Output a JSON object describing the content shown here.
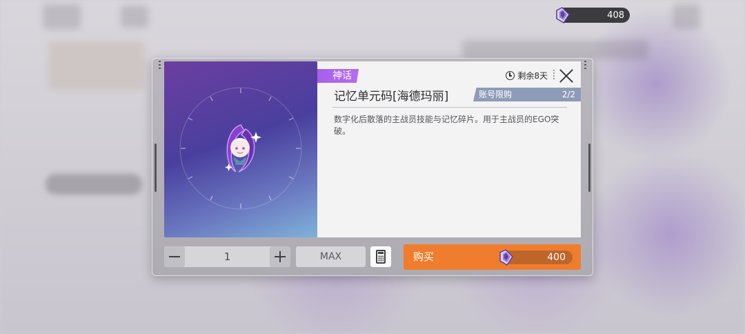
{
  "top_bar": {
    "currency_amount": "408",
    "currency_icon": "crystal-icon"
  },
  "dialog": {
    "rarity": "神话",
    "item_name": "记忆单元码[海德玛丽]",
    "timer_text": "剩余8天",
    "limit_label": "账号限购",
    "limit_count": "2/2",
    "description": "数字化后散落的主战员技能与记忆碎片。用于主战员的EGO突破。",
    "rarity_color": "#b46df0",
    "icons": [
      "clock-icon",
      "close-icon",
      "minus-icon",
      "plus-icon",
      "calculator-icon",
      "crystal-icon"
    ]
  },
  "controls": {
    "quantity": "1",
    "max_label": "MAX",
    "buy_label": "购买",
    "price": "400",
    "buy_color": "#f07d2e"
  }
}
